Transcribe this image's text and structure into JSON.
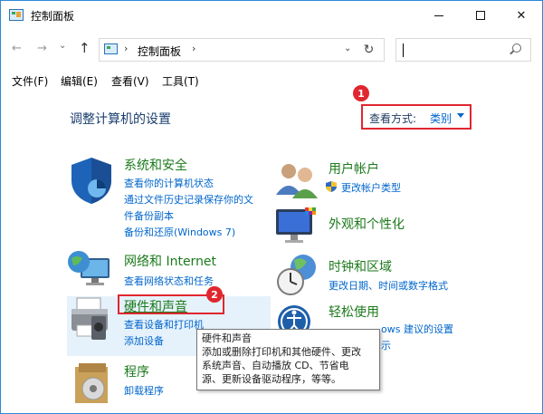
{
  "window": {
    "title": "控制面板",
    "controls": {
      "minimize": "",
      "maximize": "",
      "close": "✕"
    }
  },
  "nav": {
    "back": "←",
    "forward": "→",
    "recent": "⌄",
    "up": "↑",
    "address": "控制面板",
    "refresh": "↻",
    "search_placeholder": ""
  },
  "menu": [
    "文件(F)",
    "编辑(E)",
    "查看(V)",
    "工具(T)"
  ],
  "content": {
    "heading": "调整计算机的设置",
    "view_by_label": "查看方式:",
    "view_by_value": "类别",
    "badges": [
      "1",
      "2"
    ]
  },
  "categories": [
    {
      "title": "系统和安全",
      "links": [
        "查看你的计算机状态",
        "通过文件历史记录保存你的文",
        "件备份副本",
        "备份和还原(Windows 7)"
      ]
    },
    {
      "title": "网络和 Internet",
      "links": [
        "查看网络状态和任务"
      ]
    },
    {
      "title": "硬件和声音",
      "links": [
        "查看设备和打印机",
        "添加设备"
      ]
    },
    {
      "title": "程序",
      "links": [
        "卸载程序"
      ]
    },
    {
      "title": "用户帐户",
      "links": [
        "更改帐户类型"
      ]
    },
    {
      "title": "外观和个性化",
      "links": []
    },
    {
      "title": "时钟和区域",
      "links": [
        "更改日期、时间或数字格式"
      ]
    },
    {
      "title": "轻松使用",
      "links": [
        "ows 建议的设置",
        "示"
      ]
    }
  ],
  "tooltip": {
    "title": "硬件和声音",
    "lines": [
      "添加或删除打印机和其他硬件、更改",
      "系统声音、自动播放 CD、节省电",
      "源、更新设备驱动程序，等等。"
    ]
  },
  "colors": {
    "accent": "#0066cc",
    "category": "#1b7a1b",
    "highlight": "#e0262f"
  }
}
